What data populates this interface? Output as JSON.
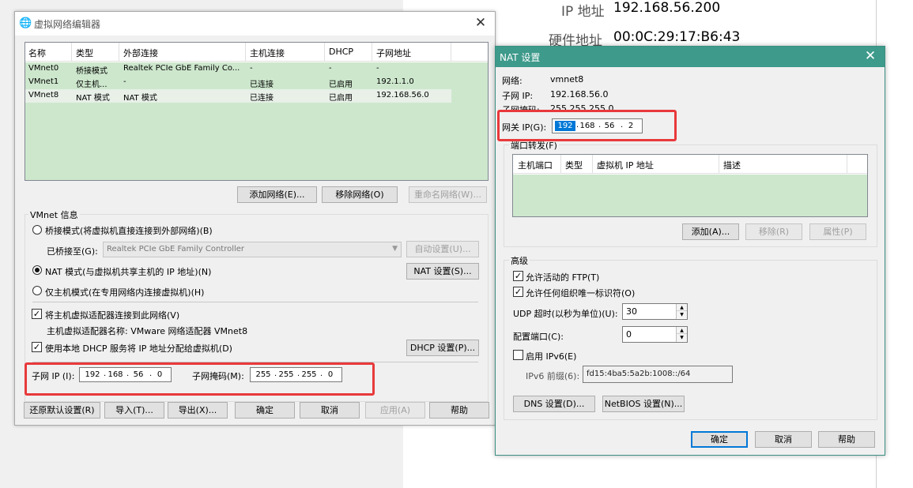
{
  "background": {
    "ip_label": "IP 地址",
    "ip_value": "192.168.56.200",
    "mac_label": "硬件地址",
    "mac_value": "00:0C:29:17:B6:43"
  },
  "editor": {
    "title": "虚拟网络编辑器",
    "columns": [
      "名称",
      "类型",
      "外部连接",
      "主机连接",
      "DHCP",
      "子网地址"
    ],
    "rows": [
      [
        "VMnet0",
        "桥接模式",
        "Realtek PCIe GbE Family Co...",
        "-",
        "-",
        "-"
      ],
      [
        "VMnet1",
        "仅主机...",
        "-",
        "已连接",
        "已启用",
        "192.1.1.0"
      ],
      [
        "VMnet8",
        "NAT 模式",
        "NAT 模式",
        "已连接",
        "已启用",
        "192.168.56.0"
      ]
    ],
    "add_network": "添加网络(E)...",
    "remove_network": "移除网络(O)",
    "rename_network": "重命名网络(W)...",
    "vmnet_info_label": "VMnet 信息",
    "bridged_mode": "桥接模式(将虚拟机直接连接到外部网络)(B)",
    "bridged_to_label": "已桥接至(G):",
    "bridged_to_value": "Realtek PCIe GbE Family Controller",
    "auto_settings": "自动设置(U)...",
    "nat_mode": "NAT 模式(与虚拟机共享主机的 IP 地址)(N)",
    "nat_settings": "NAT 设置(S)...",
    "host_only_mode": "仅主机模式(在专用网络内连接虚拟机)(H)",
    "connect_adapter": "将主机虚拟适配器连接到此网络(V)",
    "adapter_name": "主机虚拟适配器名称: VMware 网络适配器 VMnet8",
    "use_dhcp": "使用本地 DHCP 服务将 IP 地址分配给虚拟机(D)",
    "dhcp_settings": "DHCP 设置(P)...",
    "subnet_ip_label": "子网 IP (I):",
    "subnet_ip": [
      "192",
      "168",
      "56",
      "0"
    ],
    "subnet_mask_label": "子网掩码(M):",
    "subnet_mask": [
      "255",
      "255",
      "255",
      "0"
    ],
    "restore_defaults": "还原默认设置(R)",
    "import": "导入(T)...",
    "export": "导出(X)...",
    "ok": "确定",
    "cancel": "取消",
    "apply": "应用(A)",
    "help": "帮助"
  },
  "nat": {
    "title": "NAT 设置",
    "network_label": "网络:",
    "network_value": "vmnet8",
    "subnet_ip_label": "子网 IP:",
    "subnet_ip_value": "192.168.56.0",
    "subnet_mask_label": "子网掩码:",
    "subnet_mask_value": "255.255.255.0",
    "gateway_label": "网关 IP(G):",
    "gateway_ip": [
      "192",
      "168",
      "56",
      "2"
    ],
    "port_forwarding_label": "端口转发(F)",
    "pf_columns": [
      "主机端口",
      "类型",
      "虚拟机 IP 地址",
      "描述"
    ],
    "pf_add": "添加(A)...",
    "pf_remove": "移除(R)",
    "pf_properties": "属性(P)",
    "advanced_label": "高级",
    "allow_ftp": "允许活动的 FTP(T)",
    "allow_oui": "允许任何组织唯一标识符(O)",
    "udp_timeout_label": "UDP 超时(以秒为单位)(U):",
    "udp_timeout_value": "30",
    "config_port_label": "配置端口(C):",
    "config_port_value": "0",
    "enable_ipv6": "启用 IPv6(E)",
    "ipv6_prefix_label": "IPv6 前缀(6):",
    "ipv6_prefix_value": "fd15:4ba5:5a2b:1008::/64",
    "dns_settings": "DNS 设置(D)...",
    "netbios_settings": "NetBIOS 设置(N)...",
    "ok": "确定",
    "cancel": "取消",
    "help": "帮助"
  },
  "colors": {
    "nat_titlebar": "#3e9a8b",
    "list_green": "#cde7cd",
    "highlight_red": "#e8393b",
    "selection_blue": "#0078d7"
  }
}
